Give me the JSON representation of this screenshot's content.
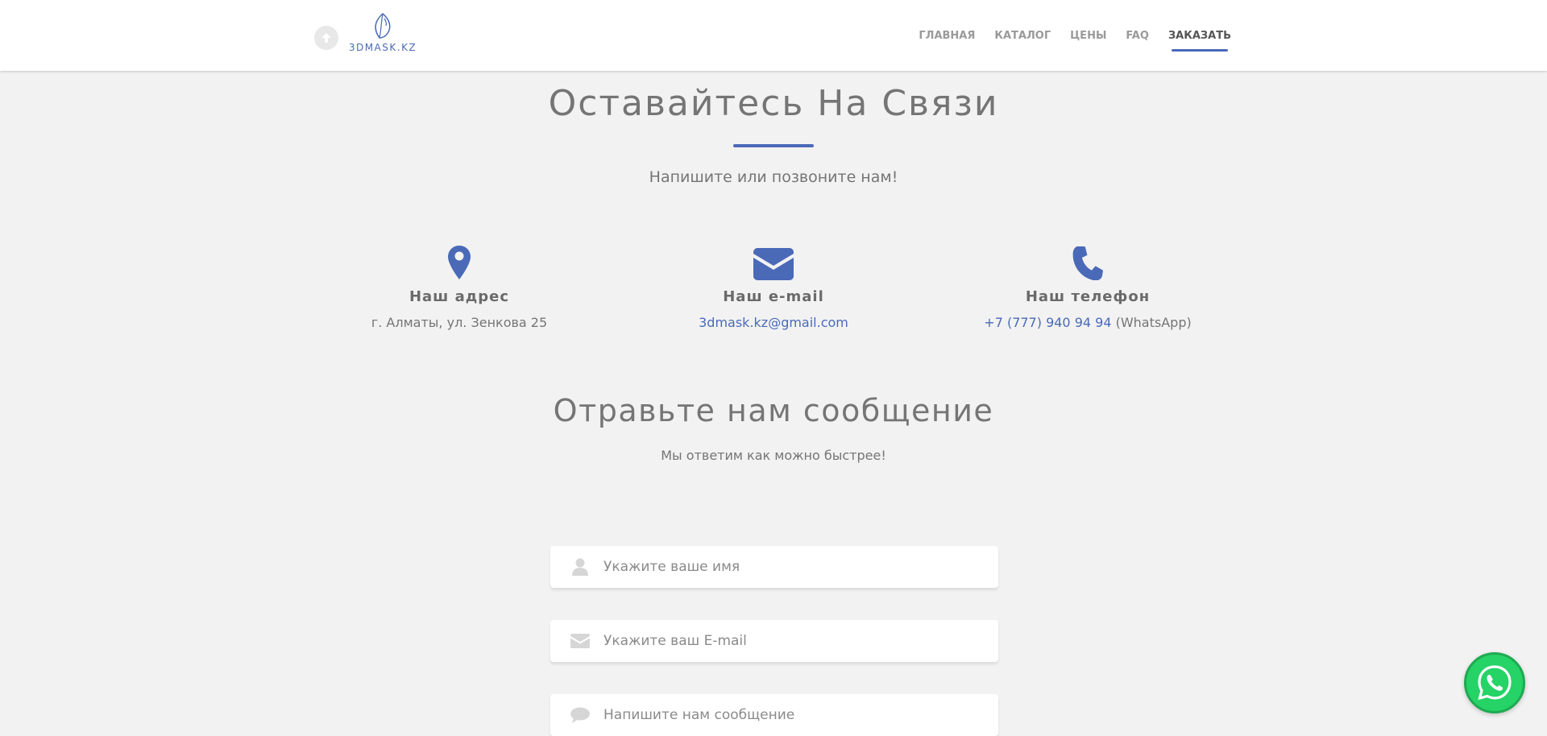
{
  "header": {
    "logo_text": "3DMASK.KZ",
    "nav": [
      {
        "label": "ГЛАВНАЯ"
      },
      {
        "label": "КАТАЛОГ"
      },
      {
        "label": "ЦЕНЫ"
      },
      {
        "label": "FAQ"
      },
      {
        "label": "ЗАКАЗАТЬ",
        "active": true
      }
    ]
  },
  "contact_section": {
    "title": "Оставайтесь На Связи",
    "subtitle": "Напишите или позвоните нам!",
    "address": {
      "icon": "map-marker-icon",
      "title": "Наш адрес",
      "value": "г. Алматы, ул. Зенкова 25"
    },
    "email": {
      "icon": "envelope-icon",
      "title": "Наш e-mail",
      "value": "3dmask.kz@gmail.com"
    },
    "phone": {
      "icon": "phone-icon",
      "title": "Наш телефон",
      "value": "+7 (777) 940 94 94",
      "suffix": "(WhatsApp)"
    }
  },
  "message_section": {
    "title": "Отравьте нам сообщение",
    "subtitle": "Мы ответим как можно быстрее!",
    "fields": {
      "name_placeholder": "Укажите ваше имя",
      "email_placeholder": "Укажите ваш E-mail",
      "message_placeholder": "Напишите нам сообщение"
    }
  },
  "colors": {
    "accent": "#4a6ab8",
    "background": "#f2f2f2",
    "text": "#757575",
    "whatsapp": "#25d366"
  },
  "floating": {
    "icon": "whatsapp-icon"
  }
}
